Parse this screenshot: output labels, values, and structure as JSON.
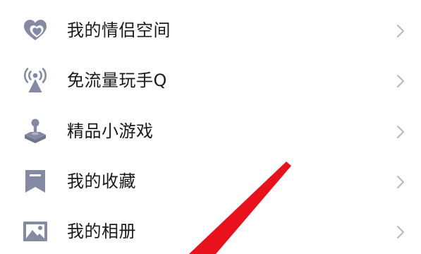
{
  "menu": {
    "items": [
      {
        "label": "我的情侣空间",
        "icon": "couple-heart-icon"
      },
      {
        "label": "免流量玩手Q",
        "icon": "broadcast-signal-icon"
      },
      {
        "label": "精品小游戏",
        "icon": "joystick-icon"
      },
      {
        "label": "我的收藏",
        "icon": "bookmark-icon"
      },
      {
        "label": "我的相册",
        "icon": "photo-album-icon"
      }
    ]
  },
  "colors": {
    "icon": "#858aa3",
    "text": "#1a1a1a",
    "chevron": "#b8b8b8",
    "annotation_arrow": "#e8111c"
  }
}
